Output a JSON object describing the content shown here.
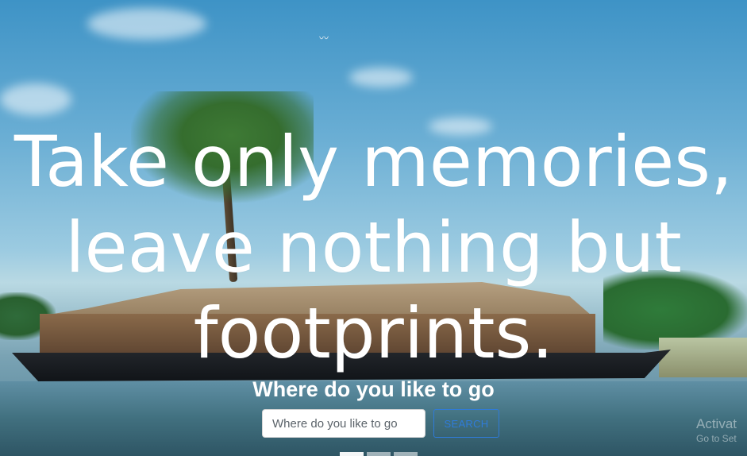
{
  "hero": {
    "headline": "Take only memories,\nleave nothing but\nfootprints.",
    "subtitle": "Where do you like to go"
  },
  "search": {
    "placeholder": "Where do you like to go",
    "value": "",
    "button_label": "SEARCH"
  },
  "carousel": {
    "indicator_count": 3,
    "active_index": 0
  },
  "watermark": {
    "line1": "Activat",
    "line2": "Go to Set"
  },
  "colors": {
    "text": "#ffffff",
    "button_accent": "#2f7bd8"
  }
}
